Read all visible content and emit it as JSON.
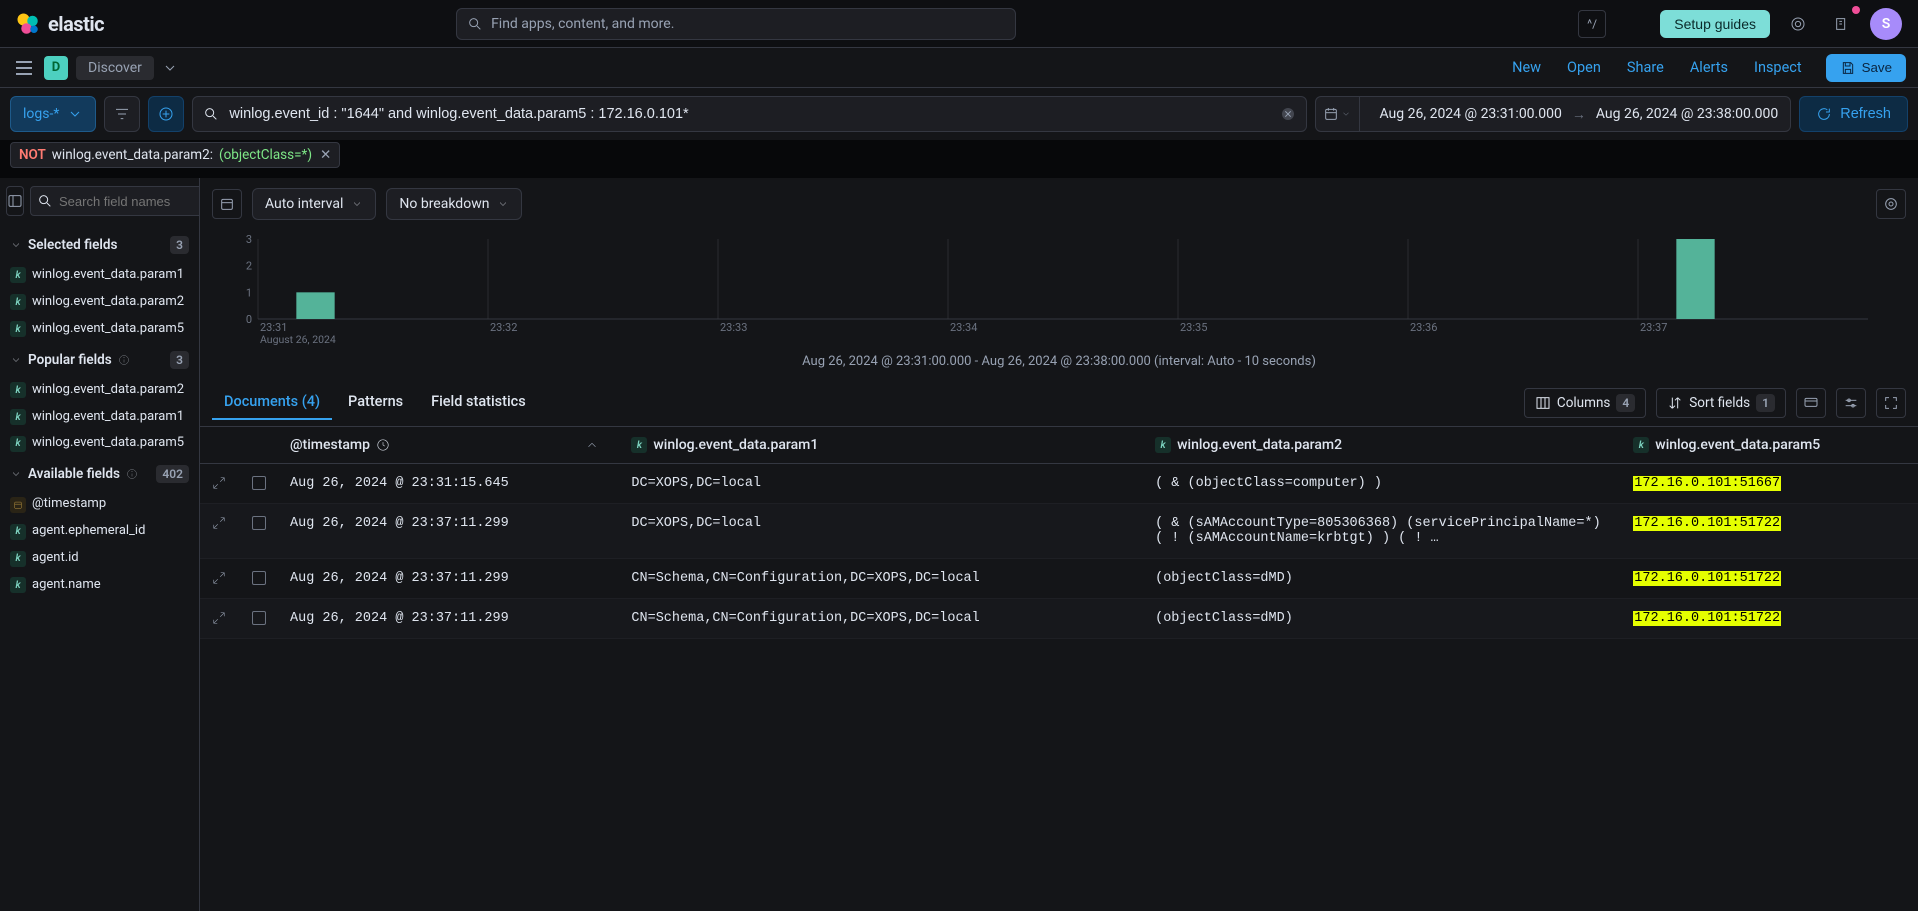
{
  "header": {
    "brand": "elastic",
    "search_placeholder": "Find apps, content, and more.",
    "kbd_hint": "^/",
    "setup_guides": "Setup guides",
    "avatar_initial": "S"
  },
  "app_bar": {
    "app_initial": "D",
    "app_name": "Discover",
    "links": [
      "New",
      "Open",
      "Share",
      "Alerts",
      "Inspect"
    ],
    "save": "Save"
  },
  "query": {
    "data_view": "logs-*",
    "kql": "winlog.event_id : \"1644\" and winlog.event_data.param5 : 172.16.0.101*",
    "date_from": "Aug 26, 2024 @ 23:31:00.000",
    "date_to": "Aug 26, 2024 @ 23:38:00.000",
    "refresh": "Refresh"
  },
  "filter_pill": {
    "not": "NOT",
    "key": "winlog.event_data.param2:",
    "value": "(objectClass=*)"
  },
  "sidebar": {
    "search_placeholder": "Search field names",
    "filter_count": "0",
    "sections": {
      "selected": {
        "title": "Selected fields",
        "count": "3"
      },
      "popular": {
        "title": "Popular fields",
        "count": "3"
      },
      "available": {
        "title": "Available fields",
        "count": "402"
      }
    },
    "selected_fields": [
      {
        "type": "k",
        "name": "winlog.event_data.param1"
      },
      {
        "type": "k",
        "name": "winlog.event_data.param2"
      },
      {
        "type": "k",
        "name": "winlog.event_data.param5"
      }
    ],
    "popular_fields": [
      {
        "type": "k",
        "name": "winlog.event_data.param2"
      },
      {
        "type": "k",
        "name": "winlog.event_data.param1"
      },
      {
        "type": "k",
        "name": "winlog.event_data.param5"
      }
    ],
    "available_fields": [
      {
        "type": "ts",
        "name": "@timestamp"
      },
      {
        "type": "k",
        "name": "agent.ephemeral_id"
      },
      {
        "type": "k",
        "name": "agent.id"
      },
      {
        "type": "k",
        "name": "agent.name"
      }
    ]
  },
  "histogram": {
    "auto_interval": "Auto interval",
    "breakdown": "No breakdown",
    "caption": "Aug 26, 2024 @ 23:31:00.000 - Aug 26, 2024 @ 23:38:00.000 (interval: Auto - 10 seconds)"
  },
  "chart_data": {
    "type": "bar",
    "y_ticks": [
      0,
      1,
      2,
      3
    ],
    "ylim": [
      0,
      3
    ],
    "x_ticks": [
      "23:31",
      "23:32",
      "23:33",
      "23:34",
      "23:35",
      "23:36",
      "23:37"
    ],
    "x_sublabel": "August 26, 2024",
    "bars": [
      {
        "bucket_start": "23:31:10",
        "value": 1
      },
      {
        "bucket_start": "23:37:10",
        "value": 3
      }
    ]
  },
  "tabs": {
    "documents": "Documents (4)",
    "patterns": "Patterns",
    "field_stats": "Field statistics",
    "columns": "Columns",
    "columns_count": "4",
    "sort_fields": "Sort fields",
    "sort_count": "1"
  },
  "table": {
    "columns": [
      {
        "label": "@timestamp",
        "type": "ts",
        "sort": "desc"
      },
      {
        "label": "winlog.event_data.param1",
        "type": "k"
      },
      {
        "label": "winlog.event_data.param2",
        "type": "k"
      },
      {
        "label": "winlog.event_data.param5",
        "type": "k"
      }
    ],
    "rows": [
      {
        "ts": "Aug 26, 2024 @ 23:31:15.645",
        "p1": "DC=XOPS,DC=local",
        "p2": " ( &  (objectClass=computer) ) ",
        "p5": "172.16.0.101:51667"
      },
      {
        "ts": "Aug 26, 2024 @ 23:37:11.299",
        "p1": "DC=XOPS,DC=local",
        "p2": " ( &  (sAMAccountType=805306368) (servicePrincipalName=*) ( ! (sAMAccountName=krbtgt) ) ( !  …",
        "p5": "172.16.0.101:51722"
      },
      {
        "ts": "Aug 26, 2024 @ 23:37:11.299",
        "p1": "CN=Schema,CN=Configuration,DC=XOPS,DC=local",
        "p2": "(objectClass=dMD)",
        "p5": "172.16.0.101:51722"
      },
      {
        "ts": "Aug 26, 2024 @ 23:37:11.299",
        "p1": "CN=Schema,CN=Configuration,DC=XOPS,DC=local",
        "p2": "(objectClass=dMD)",
        "p5": "172.16.0.101:51722"
      }
    ]
  }
}
